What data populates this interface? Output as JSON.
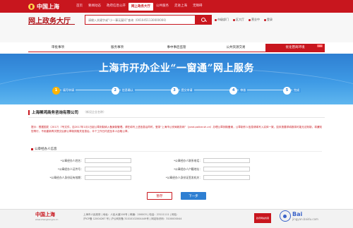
{
  "topbar": {
    "logo": "中国上海",
    "nav": [
      "首页",
      "要闻动态",
      "政府信息公开",
      "网上政务大厅",
      "公共服务",
      "走进上海",
      "无障碍"
    ],
    "active_index": 3
  },
  "header": {
    "title": "网上政务大厅",
    "search_placeholder": "请输入关键字或“小一事无疑问”查询（0010451130000000）",
    "locations": [
      "市级部门",
      "区大厅",
      "营业中",
      "登录"
    ]
  },
  "tabs": {
    "items": [
      "审批事项",
      "服务事项",
      "事中事后监管",
      "公共资源交易",
      "优化营商环境"
    ],
    "active_index": 4,
    "new_badge": "new"
  },
  "banner": {
    "title": "上海市开办企业“一窗通”网上服务",
    "steps": [
      {
        "num": "1",
        "label": "填写申请"
      },
      {
        "num": "2",
        "label": "信息确认"
      },
      {
        "num": "3",
        "label": "提交申请"
      },
      {
        "num": "4",
        "label": "审核"
      },
      {
        "num": "5",
        "label": "完成"
      }
    ]
  },
  "company": {
    "name": "上海稀鸿商务咨询有限公司",
    "sub": "（新设企业名称）"
  },
  "notice": "提示：根据国发〔2017〕7号文件，自2017年1月1日起公章刻制纳入备案制管理。请在填写上述信息后同时，登录“上海市公安局政务网”（yzxd.police.sh.cn）办理公章刻制备案，公章制作人信息请填写入实体一致，如未按要求填报将可能无法刻制，将通知您再行，不用重新再次提交后即公章制刻相关信息后，半个工作日内送至本人自取公章。",
  "section": {
    "title": "公章经办人信息"
  },
  "form": {
    "left": [
      "*公章经办人姓名：",
      "*公章经办人证件号：",
      "*公章经办人身份证有效期："
    ],
    "right": [
      "*公章经办人联系电话：",
      "*公章经办人户籍地址：",
      "*公章经办人身份证签发机关："
    ]
  },
  "buttons": {
    "save": "暂存",
    "next": "下一步"
  },
  "footer": {
    "logo": "中国上海",
    "url": "www.shanghai.gov.cn",
    "info_lines": [
      "上海市人民政府 | 地址：人民大道200号 | 邮编：200003 | 电话：23111111 | 网站：",
      "沪ICP备 12004267 号 | 沪公网安备 31010102004449号 | 网站标识码：3100000044"
    ],
    "badge": "政府网站找错",
    "watermark_main": "Bai",
    "watermark_sub": "jingyan.baidu.com"
  },
  "colors": {
    "brand_red": "#c8161e",
    "banner_blue": "#2e7fd2",
    "step_active": "#ffb400"
  }
}
